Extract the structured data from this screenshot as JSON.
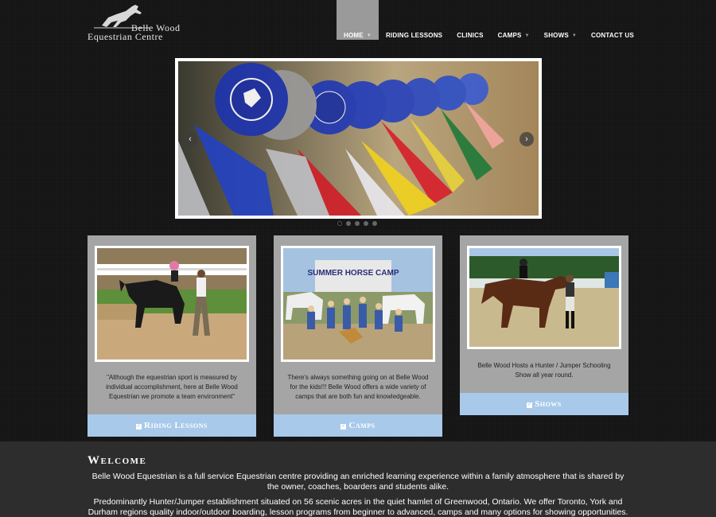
{
  "logo": {
    "line1": "Belle Wood",
    "line2": "Equestrian Centre"
  },
  "nav": [
    {
      "label": "HOME",
      "dropdown": true
    },
    {
      "label": "RIDING LESSONS",
      "dropdown": false
    },
    {
      "label": "CLINICS",
      "dropdown": false
    },
    {
      "label": "CAMPS",
      "dropdown": true
    },
    {
      "label": "SHOWS",
      "dropdown": true
    },
    {
      "label": "CONTACT US",
      "dropdown": false
    }
  ],
  "slider": {
    "prev": "‹",
    "next": "›",
    "slide_count": 5,
    "active_slide": 1
  },
  "cards": [
    {
      "caption": "\"Although the equestrian sport is measured by individual accomplishment, here at Belle Wood Equestrian we promote a team environment\"",
      "cta": "Riding Lessons"
    },
    {
      "caption": "There's always something going on at Belle Wood for the kids!!! Belle Wood offers a wide variety of camps that are both fun and knowledgeable.",
      "cta": "Camps",
      "photo_sign": "SUMMER HORSE CAMP"
    },
    {
      "caption": "Belle Wood Hosts a Hunter / Jumper Schooling Show all year round.",
      "cta": "Shows"
    }
  ],
  "welcome": {
    "title": "Welcome",
    "p1": "Belle Wood Equestrian is a full service Equestrian centre providing an enriched learning experience within a family atmosphere that is shared by the owner, coaches, boarders and students alike.",
    "p2": "Predominantly  Hunter/Jumper establishment situated on 56 scenic acres in the quiet hamlet of Greenwood, Ontario. We offer Toronto, York and Durham regions quality indoor/outdoor boarding, lesson programs from beginner to advanced, camps and many options for showing opportunities."
  },
  "colors": {
    "nav_active": "#9a9a9a",
    "card_bg": "#a5a5a5",
    "cta_bg": "#a8c9ea",
    "welcome_bg": "#2d2d2d"
  }
}
